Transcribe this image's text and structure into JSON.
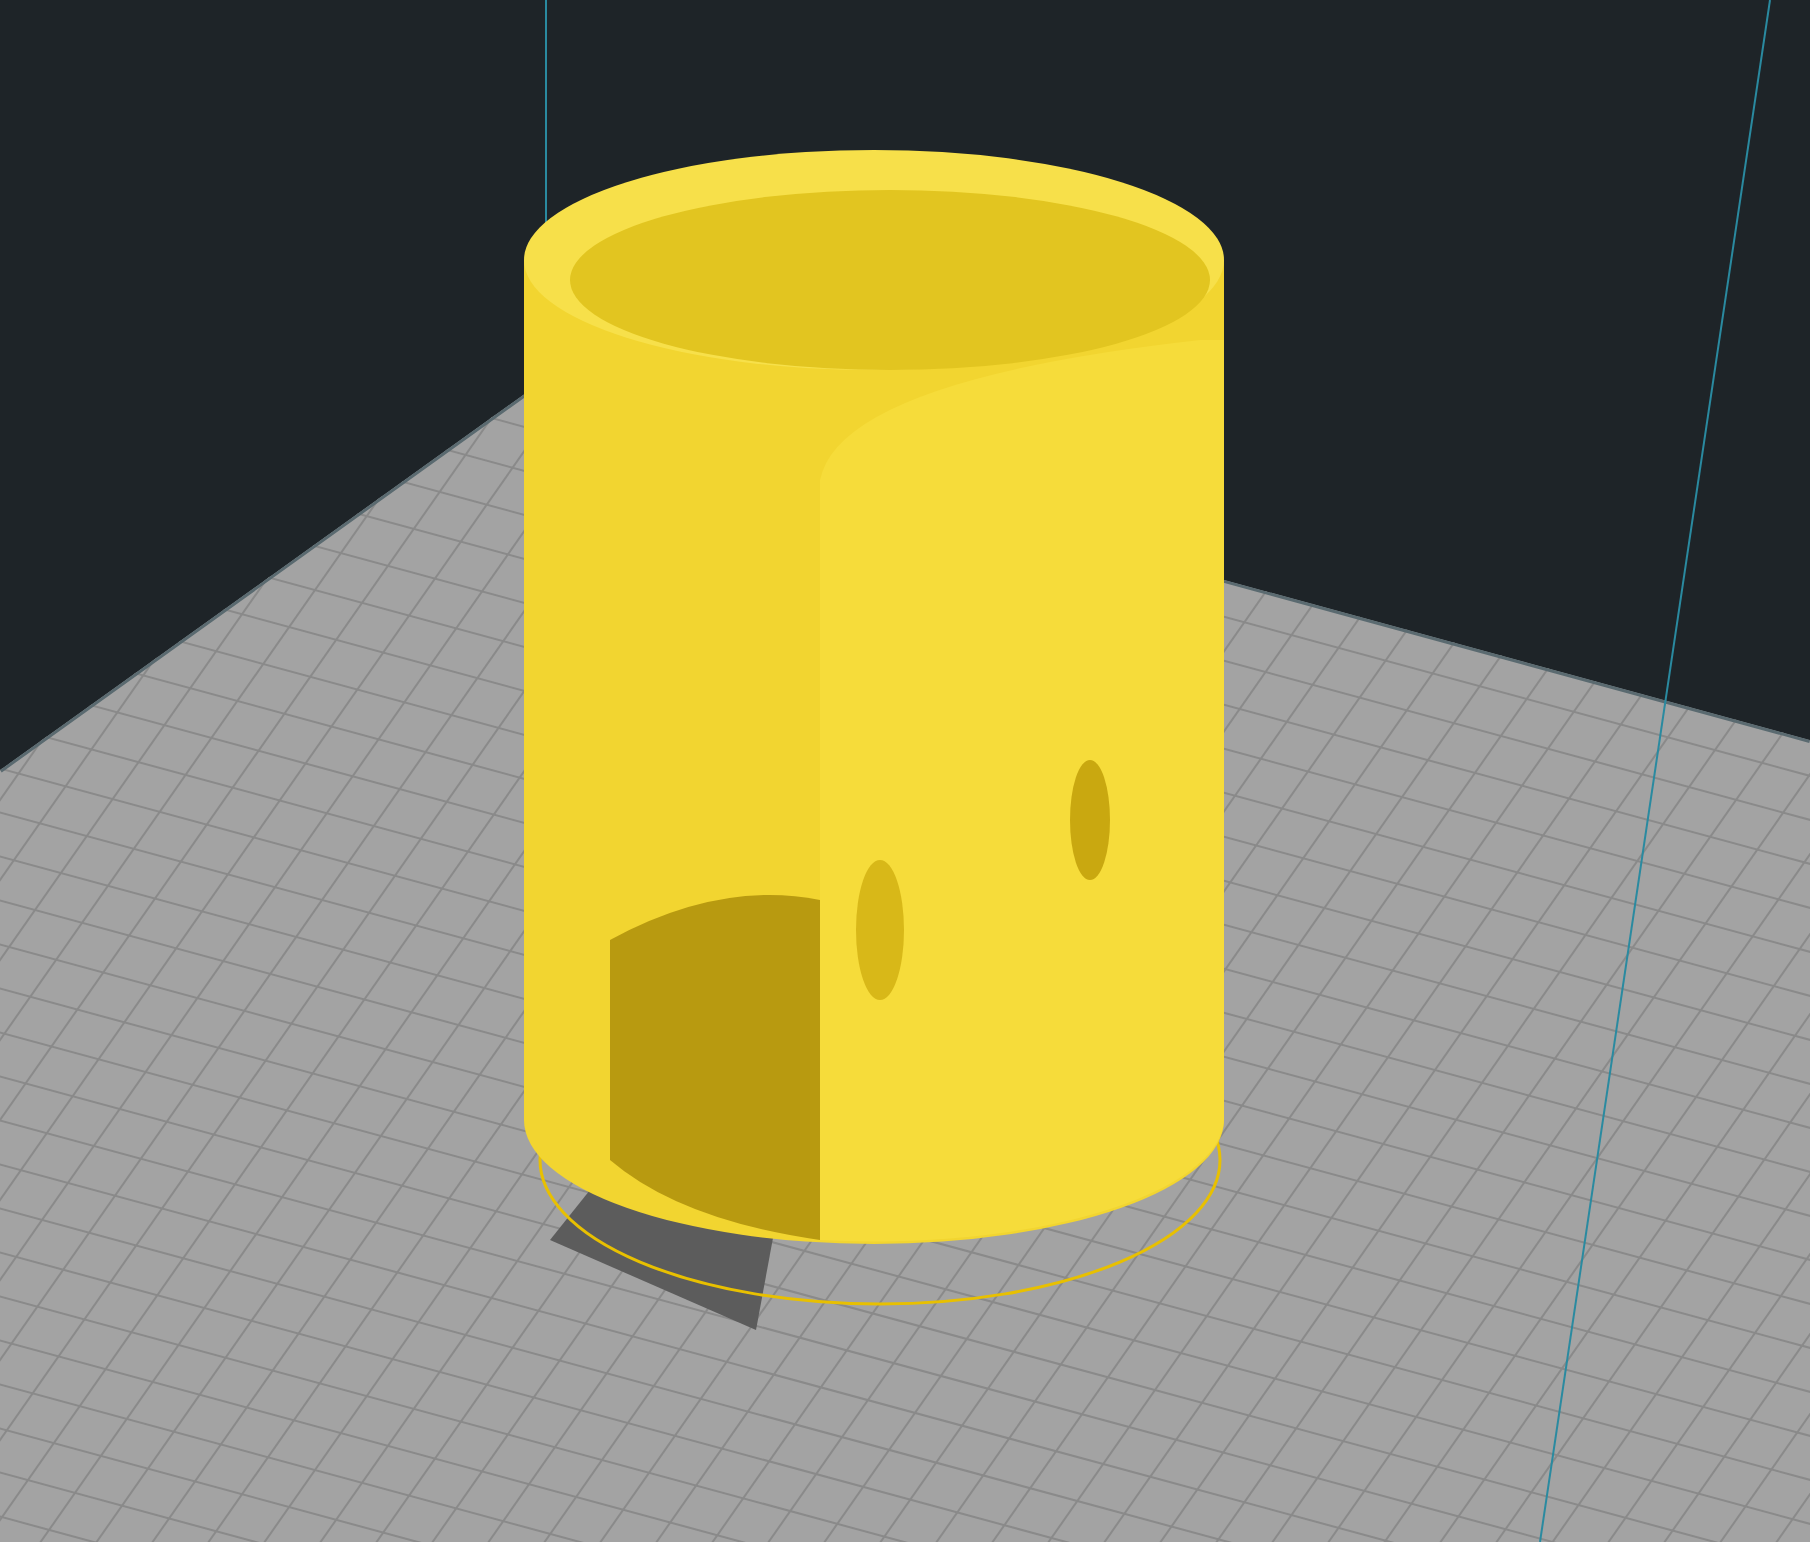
{
  "viewport": {
    "model": {
      "kind": "cylinder"
    }
  }
}
